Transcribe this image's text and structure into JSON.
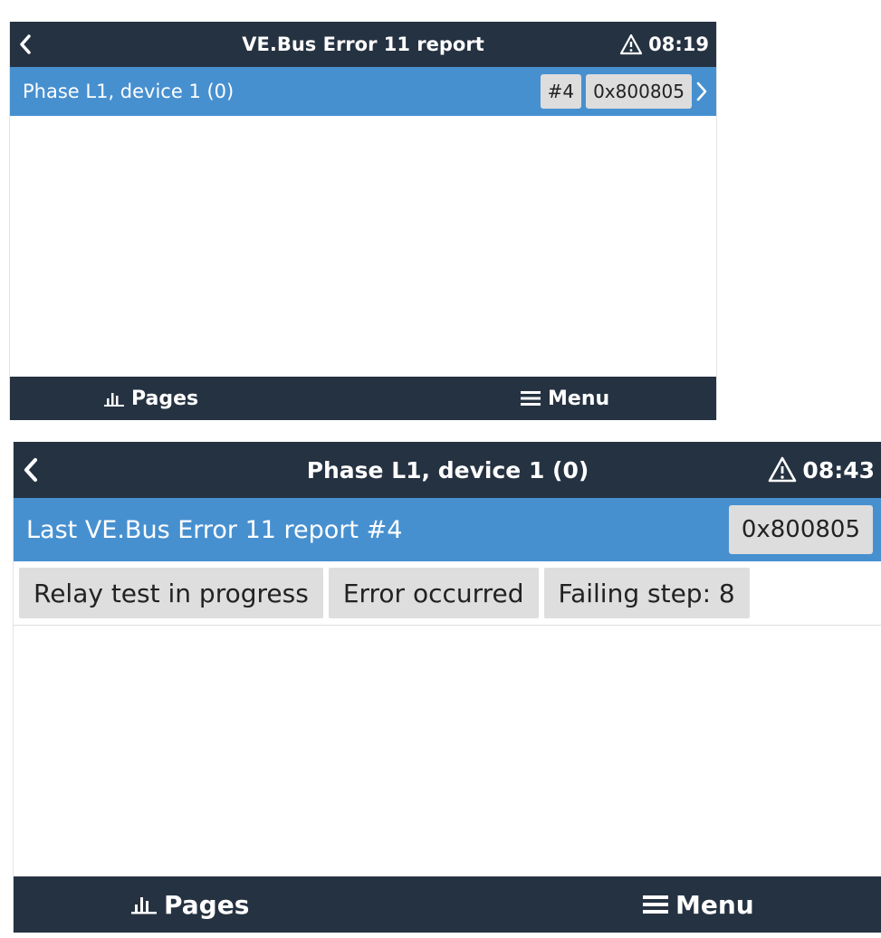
{
  "screen1": {
    "header": {
      "back_icon": "chevron-left-icon",
      "title": "VE.Bus Error 11 report",
      "alarm_icon": "warning-triangle-icon",
      "time": "08:19"
    },
    "row": {
      "label": "Phase L1, device 1 (0)",
      "index_badge": "#4",
      "code_badge": "0x800805",
      "chevron_icon": "chevron-right-icon"
    },
    "footer": {
      "pages_icon": "bar-chart-icon",
      "pages_label": "Pages",
      "menu_icon": "hamburger-icon",
      "menu_label": "Menu"
    }
  },
  "screen2": {
    "header": {
      "back_icon": "chevron-left-icon",
      "title": "Phase L1, device 1 (0)",
      "alarm_icon": "warning-triangle-icon",
      "time": "08:43"
    },
    "row": {
      "label": "Last VE.Bus Error 11 report #4",
      "code_badge": "0x800805"
    },
    "flags": [
      "Relay test in progress",
      "Error occurred",
      "Failing step: 8"
    ],
    "footer": {
      "pages_icon": "bar-chart-icon",
      "pages_label": "Pages",
      "menu_icon": "hamburger-icon",
      "menu_label": "Menu"
    }
  },
  "colors": {
    "header_bg": "#253241",
    "row_bg": "#4790d0",
    "badge_bg": "#dddddd"
  }
}
